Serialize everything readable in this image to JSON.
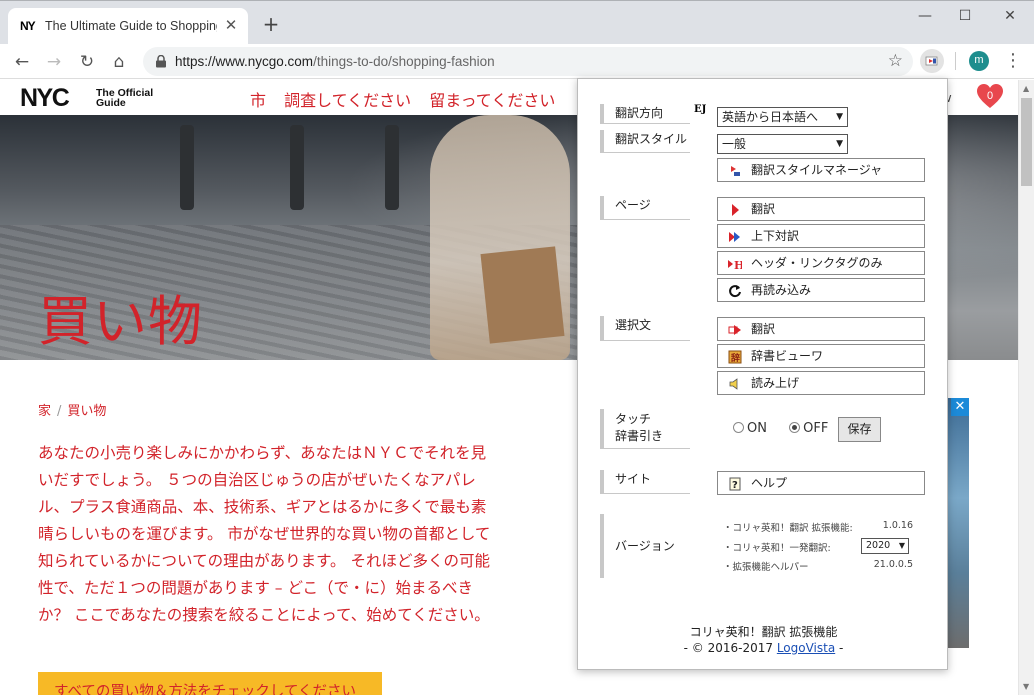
{
  "browser": {
    "tab_title": "The Ultimate Guide to Shopping",
    "favicon_text": "NY",
    "url_host": "https://www.nycgo.com",
    "url_path": "/things-to-do/shopping-fashion",
    "avatar_letter": "m"
  },
  "site": {
    "logo": "NYC",
    "logo_sub_1": "The Official",
    "logo_sub_2": "Guide",
    "nav": [
      "市",
      "調査してください",
      "留まってください"
    ],
    "heart_count": "0",
    "hero_title": "買い物",
    "breadcrumb": {
      "home": "家",
      "sep": "/",
      "current": "買い物"
    },
    "intro": "あなたの小売り楽しみにかかわらず、あなたはＮＹＣでそれを見いだすでしょう。 ５つの自治区じゅうの店がぜいたくなアパレル、プラス食通商品、本、技術系、ギアとはるかに多くで最も素晴らしいものを運びます。 市がなぜ世界的な買い物の首都として知られているかについての理由があります。 それほど多くの可能性で、ただ１つの問題があります – どこ（で・に）始まるべきか？ ここであなたの捜索を絞ることによって、始めてください。",
    "cta": "すべての買い物＆方法をチェックしてください",
    "accent_color": "#d2232a",
    "cta_color": "#f7b926"
  },
  "popup": {
    "ej": "EJ",
    "direction": {
      "label": "翻訳方向",
      "value": "英語から日本語へ"
    },
    "style": {
      "label": "翻訳スタイル",
      "value": "一般",
      "manager": "翻訳スタイルマネージャ"
    },
    "page": {
      "label": "ページ",
      "translate": "翻訳",
      "parallel": "上下対訳",
      "header_links": "ヘッダ・リンクタグのみ",
      "reload": "再読み込み"
    },
    "selection": {
      "label": "選択文",
      "translate": "翻訳",
      "dictionary": "辞書ビューワ",
      "read_aloud": "読み上げ"
    },
    "touch": {
      "label_1": "タッチ",
      "label_2": "辞書引き",
      "on": "ON",
      "off": "OFF",
      "selected": "OFF",
      "save": "保存"
    },
    "site": {
      "label": "サイト",
      "help": "ヘルプ"
    },
    "version": {
      "label": "バージョン",
      "rows": [
        {
          "name": "・コリャ英和！翻訳 拡張機能:",
          "value": "1.0.16"
        },
        {
          "name": "・コリャ英和！一発翻訳:",
          "value": "2020"
        },
        {
          "name": "・拡張機能ヘルパー",
          "value": "21.0.0.5"
        }
      ]
    },
    "footer_title": "コリャ英和！翻訳 拡張機能",
    "footer_prefix": "- © 2016-2017",
    "footer_link": "LogoVista",
    "footer_suffix": "-"
  }
}
